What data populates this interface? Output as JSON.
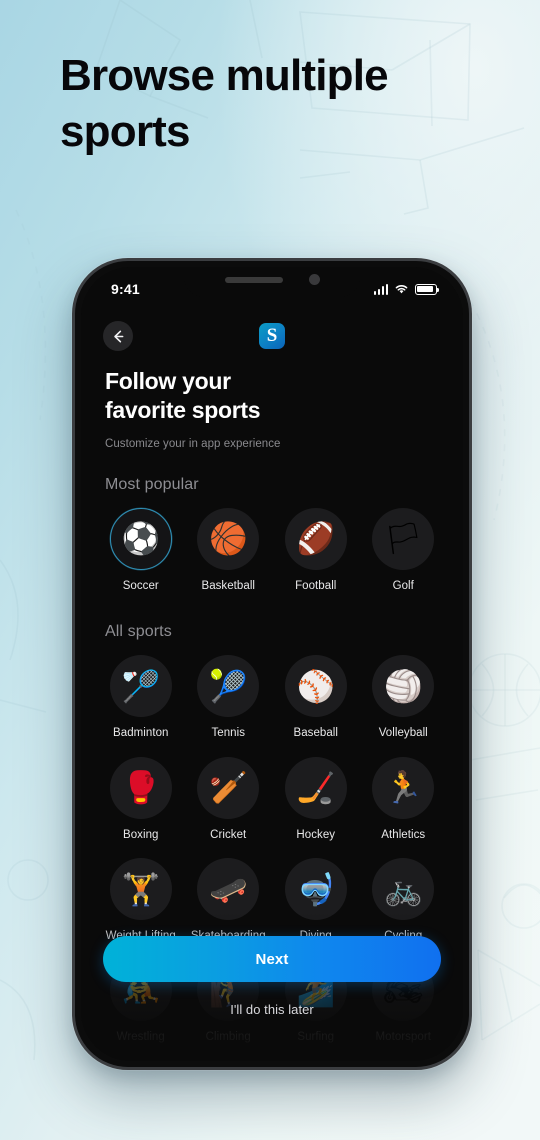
{
  "page": {
    "headline": "Browse multiple sports",
    "background_colors": {
      "left": "#a9d6e4",
      "right": "#f4faf8"
    }
  },
  "phone": {
    "status_bar": {
      "time": "9:41",
      "icons": [
        "signal-bars-icon",
        "wifi-icon",
        "battery-icon"
      ]
    },
    "top_bar": {
      "back_icon": "arrow-left-icon",
      "brand_logo": "S"
    },
    "header": {
      "title_line1": "Follow your",
      "title_line2": "favorite sports",
      "subtitle": "Customize your in app experience"
    },
    "sections": [
      {
        "id": "most-popular",
        "title": "Most popular",
        "items": [
          {
            "label": "Soccer",
            "icon": "⚽",
            "icon_name": "soccer-ball-icon",
            "selected": true
          },
          {
            "label": "Basketball",
            "icon": "🏀",
            "icon_name": "basketball-icon",
            "selected": false
          },
          {
            "label": "Football",
            "icon": "🏈",
            "icon_name": "american-football-icon",
            "selected": false
          },
          {
            "label": "Golf",
            "icon": "🏳",
            "icon_name": "golf-ball-icon",
            "selected": false
          }
        ]
      },
      {
        "id": "all-sports",
        "title": "All sports",
        "items": [
          {
            "label": "Badminton",
            "icon": "🏸",
            "icon_name": "badminton-icon",
            "selected": false
          },
          {
            "label": "Tennis",
            "icon": "🎾",
            "icon_name": "tennis-ball-icon",
            "selected": false
          },
          {
            "label": "Baseball",
            "icon": "⚾",
            "icon_name": "baseball-icon",
            "selected": false
          },
          {
            "label": "Volleyball",
            "icon": "🏐",
            "icon_name": "volleyball-icon",
            "selected": false
          },
          {
            "label": "Boxing",
            "icon": "🥊",
            "icon_name": "boxing-glove-icon",
            "selected": false
          },
          {
            "label": "Cricket",
            "icon": "🏏",
            "icon_name": "cricket-bat-icon",
            "selected": false
          },
          {
            "label": "Hockey",
            "icon": "🏒",
            "icon_name": "hockey-sticks-icon",
            "selected": false
          },
          {
            "label": "Athletics",
            "icon": "🏃",
            "icon_name": "athletics-icon",
            "selected": false
          },
          {
            "label": "Weight Lifting",
            "icon": "🏋",
            "icon_name": "weight-lifting-icon",
            "selected": false
          },
          {
            "label": "Skateboarding",
            "icon": "🛹",
            "icon_name": "skateboard-icon",
            "selected": false
          },
          {
            "label": "Diving",
            "icon": "🤿",
            "icon_name": "diving-mask-icon",
            "selected": false
          },
          {
            "label": "Cycling",
            "icon": "🚲",
            "icon_name": "bicycle-icon",
            "selected": false
          },
          {
            "label": "Wrestling",
            "icon": "🤼",
            "icon_name": "wrestling-icon",
            "selected": false
          },
          {
            "label": "Climbing",
            "icon": "🧗",
            "icon_name": "climbing-icon",
            "selected": false
          },
          {
            "label": "Surfing",
            "icon": "🏄",
            "icon_name": "surfing-icon",
            "selected": false
          },
          {
            "label": "Motorsport",
            "icon": "🏍",
            "icon_name": "motorcycle-icon",
            "selected": false
          }
        ]
      }
    ],
    "footer": {
      "primary_label": "Next",
      "secondary_label": "I'll do this later",
      "primary_gradient_from": "#00b2d8",
      "primary_gradient_to": "#1070ef"
    }
  }
}
